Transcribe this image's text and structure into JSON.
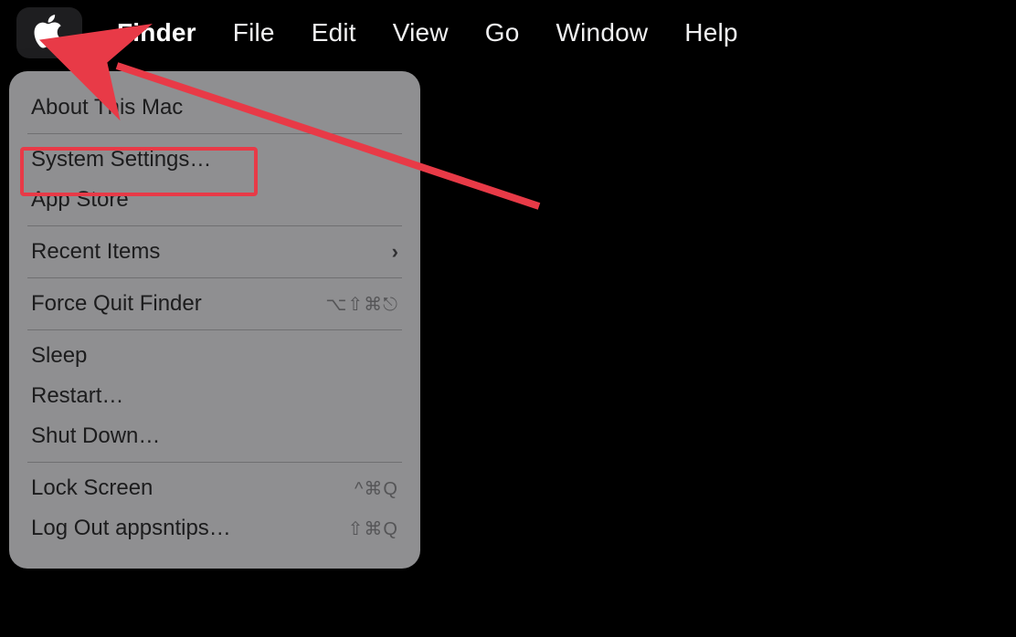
{
  "menubar": {
    "app_name": "Finder",
    "items": [
      {
        "label": "File"
      },
      {
        "label": "Edit"
      },
      {
        "label": "View"
      },
      {
        "label": "Go"
      },
      {
        "label": "Window"
      },
      {
        "label": "Help"
      }
    ]
  },
  "apple_menu": {
    "about": "About This Mac",
    "system_settings": "System Settings…",
    "app_store": "App Store",
    "recent_items": "Recent Items",
    "recent_items_chevron": "›",
    "force_quit": "Force Quit Finder",
    "force_quit_sc": "⌥⇧⌘⎋",
    "sleep": "Sleep",
    "restart": "Restart…",
    "shut_down": "Shut Down…",
    "lock_screen": "Lock Screen",
    "lock_screen_sc": "^⌘Q",
    "log_out": "Log Out appsntips…",
    "log_out_sc": "⇧⌘Q"
  },
  "annotation": {
    "arrow_color": "#e83a47"
  }
}
